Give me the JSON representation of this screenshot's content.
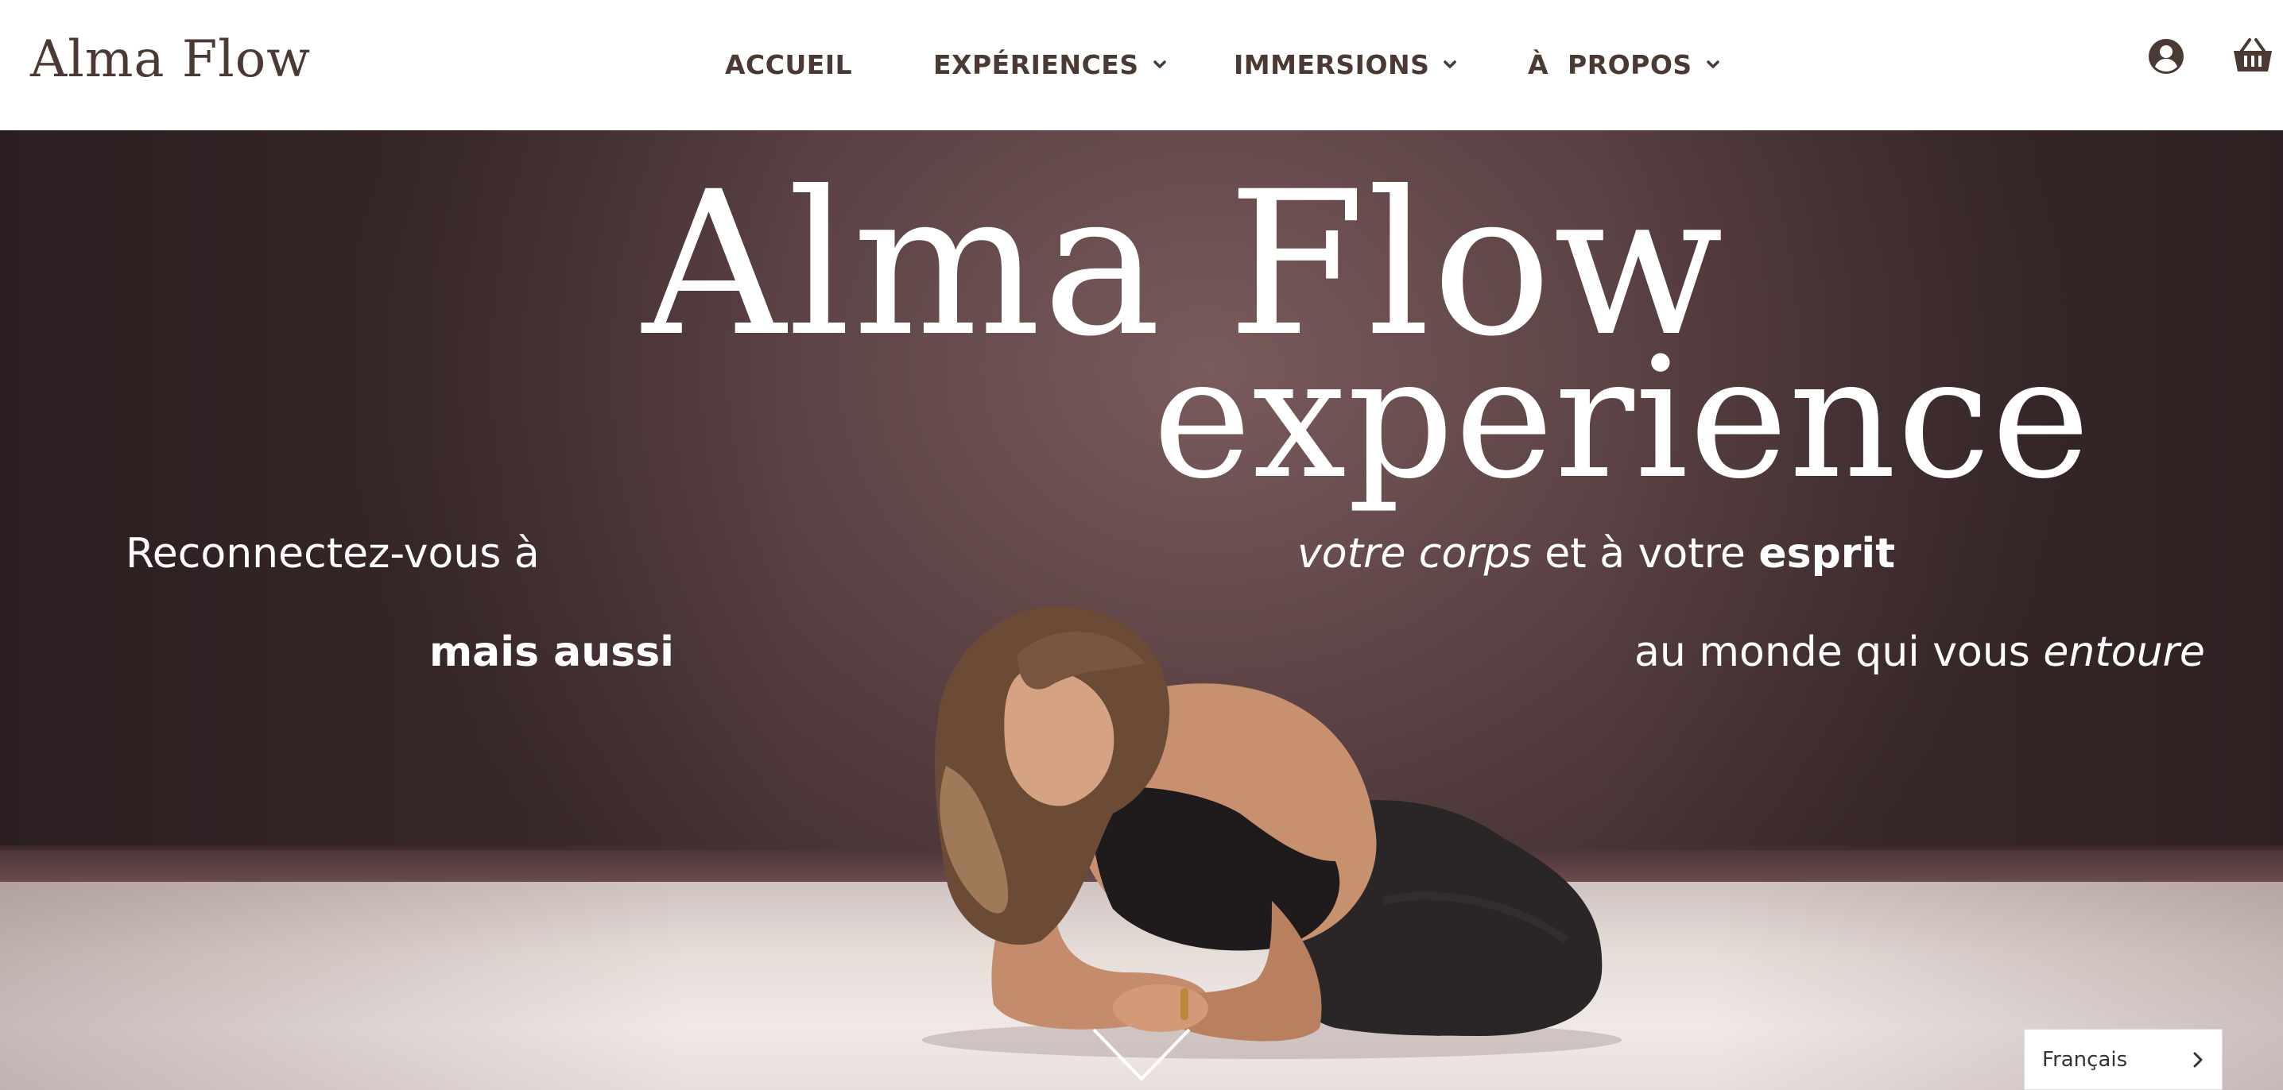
{
  "brand": {
    "logo_text": "Alma Flow"
  },
  "nav": {
    "items": [
      {
        "label": "ACCUEIL",
        "has_dropdown": false
      },
      {
        "label": "EXPÉRIENCES",
        "has_dropdown": true
      },
      {
        "label": "IMMERSIONS",
        "has_dropdown": true
      },
      {
        "label": "À  PROPOS",
        "has_dropdown": true
      }
    ],
    "icons": [
      "user-account-icon",
      "shopping-basket-icon"
    ]
  },
  "hero": {
    "title": "Alma Flow",
    "subtitle": "experience",
    "line1_left": "Reconnectez-vous à",
    "line1_right_italic": "votre corps",
    "line1_right_mid": " et à votre ",
    "line1_right_bold": "esprit",
    "line2_left_bold": "mais aussi",
    "line2_right_plain": "au monde qui vous ",
    "line2_right_italic": "entoure",
    "scroll_icon": "chevron-down-icon"
  },
  "language_selector": {
    "selected": "Français"
  },
  "colors": {
    "brand_text": "#4a3a33",
    "hero_wall": "#5e4446",
    "hero_text": "#ffffff",
    "floor": "#e6ddd9"
  }
}
